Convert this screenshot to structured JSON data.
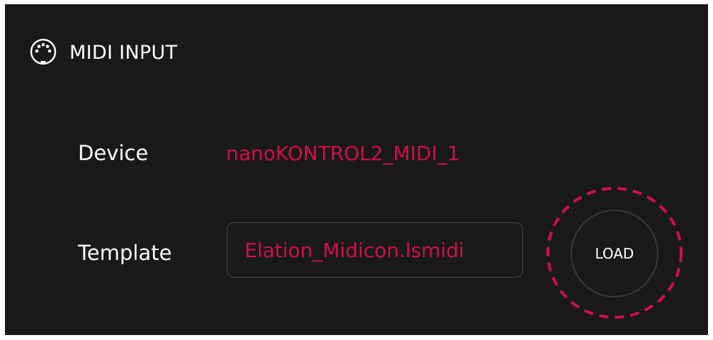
{
  "header": {
    "title": "MIDI INPUT",
    "icon": "midi-connector-icon"
  },
  "device": {
    "label": "Device",
    "value": "nanoKONTROL2_MIDI_1"
  },
  "template": {
    "label": "Template",
    "value": "Elation_Midicon.lsmidi"
  },
  "load_button": {
    "label": "LOAD",
    "highlight_ring": "dashed"
  },
  "colors": {
    "panel_background": "#1a1a1a",
    "text": "#ffffff",
    "accent": "#cf1048",
    "field_border": "#4a4a4a"
  }
}
